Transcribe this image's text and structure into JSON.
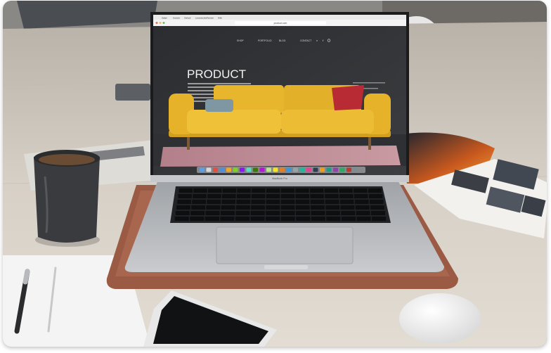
{
  "scene": {
    "kind": "photo of laptop on desk",
    "colors": {
      "table": "#cfc7bc",
      "sofa": "#e8b62c",
      "pillow_red": "#b82b34",
      "laptop_silver": "#b7b9bc",
      "leather_mat": "#9b5a44",
      "mug": "#3a3b3e"
    }
  },
  "browser": {
    "menu": [
      "Safari",
      "Ansicht",
      "Verlauf",
      "Lesezeichen",
      "Fenster",
      "Hilfe"
    ],
    "address": "product.com"
  },
  "website": {
    "nav": [
      "SHOP",
      "PORTFOLIO",
      "BLOG",
      "CONTACT"
    ],
    "hero_title": "PRODUCT"
  },
  "laptop": {
    "model_label": "MacBook Pro"
  }
}
